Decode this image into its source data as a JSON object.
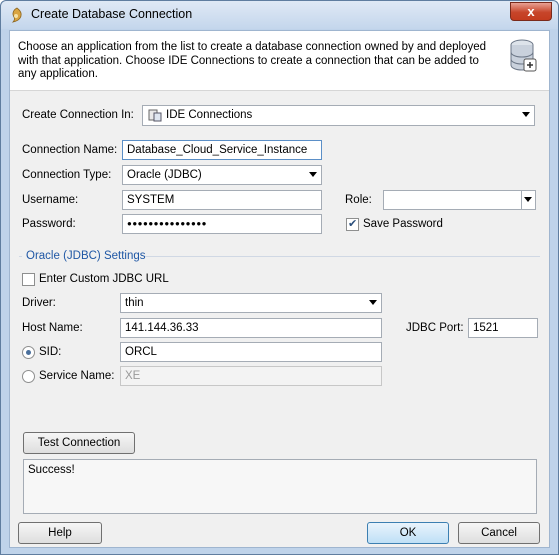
{
  "window": {
    "title": "Create Database Connection",
    "close_label": "x"
  },
  "header": {
    "description": "Choose an application from the list to create a database connection owned by and deployed with that application. Choose IDE Connections to create a connection that can be added to any application."
  },
  "create_in": {
    "label": "Create Connection In:",
    "value": "IDE Connections"
  },
  "connection_name": {
    "label": "Connection Name:",
    "value": "Database_Cloud_Service_Instance"
  },
  "connection_type": {
    "label": "Connection Type:",
    "value": "Oracle (JDBC)"
  },
  "username": {
    "label": "Username:",
    "value": "SYSTEM"
  },
  "role": {
    "label": "Role:",
    "value": ""
  },
  "password": {
    "label": "Password:",
    "value": "●●●●●●●●●●●●●●●"
  },
  "save_password": {
    "label": "Save Password",
    "checked": true
  },
  "settings_section": {
    "label": "Oracle (JDBC) Settings"
  },
  "custom_jdbc": {
    "label": "Enter Custom JDBC URL",
    "checked": false
  },
  "driver": {
    "label": "Driver:",
    "value": "thin"
  },
  "host": {
    "label": "Host Name:",
    "value": "141.144.36.33"
  },
  "jdbc_port": {
    "label": "JDBC Port:",
    "value": "1521"
  },
  "sid": {
    "label": "SID:",
    "value": "ORCL",
    "selected": true
  },
  "service_name": {
    "label": "Service Name:",
    "value": "XE",
    "selected": false
  },
  "test": {
    "button_label": "Test Connection",
    "result": "Success!"
  },
  "footer": {
    "help_label": "Help",
    "ok_label": "OK",
    "cancel_label": "Cancel"
  }
}
